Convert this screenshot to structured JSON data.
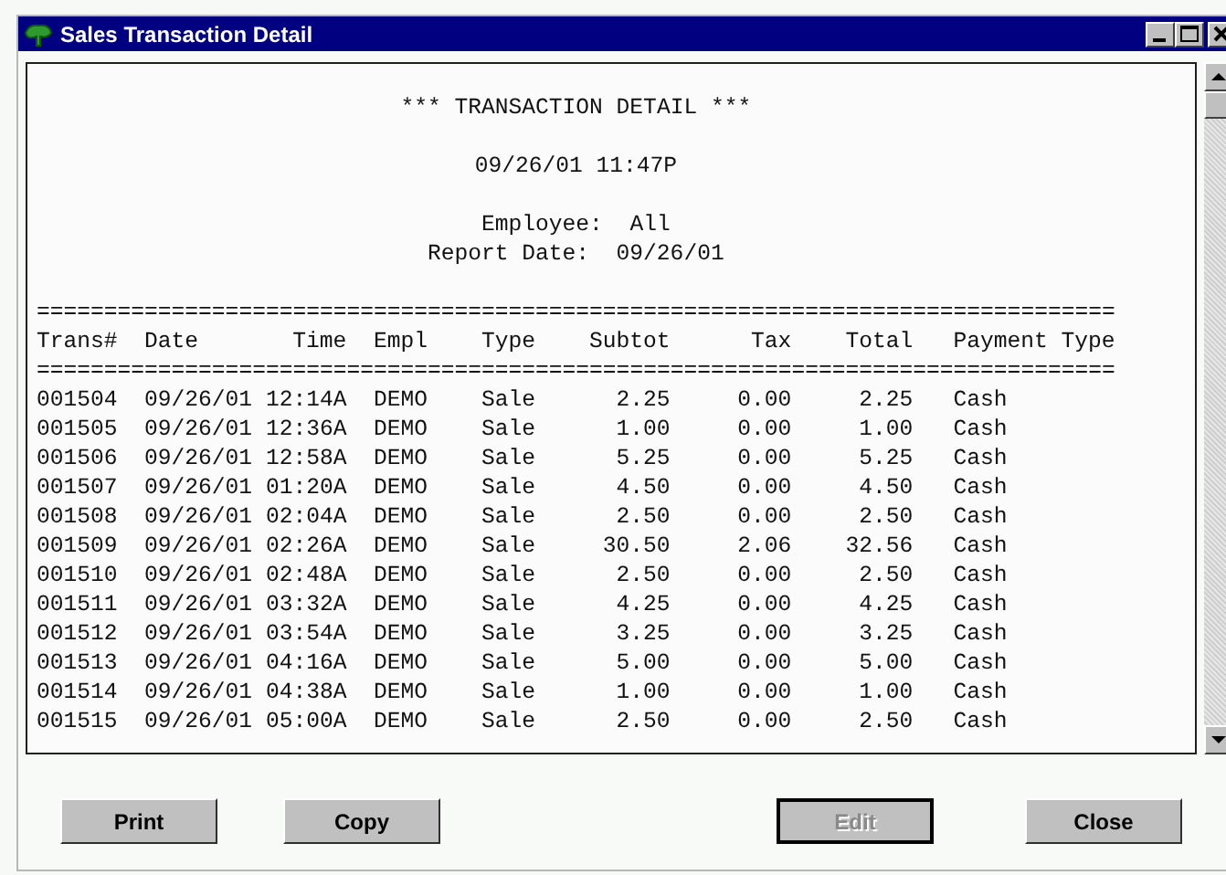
{
  "window": {
    "title": "Sales Transaction Detail"
  },
  "report": {
    "title": "*** TRANSACTION DETAIL ***",
    "timestamp": "09/26/01 11:47P",
    "employee": "Employee:  All",
    "report_date": "Report Date:  09/26/01",
    "rule_top": "================================================================================",
    "columns": [
      "Trans#",
      "Date",
      "Time",
      "Empl",
      "Type",
      "Subtot",
      "Tax",
      "Total",
      "Payment Type"
    ],
    "rule_bottom": "================================================================================",
    "rows": [
      [
        "001504",
        "09/26/01",
        "12:14A",
        "DEMO",
        "Sale",
        "2.25",
        "0.00",
        "2.25",
        "Cash"
      ],
      [
        "001505",
        "09/26/01",
        "12:36A",
        "DEMO",
        "Sale",
        "1.00",
        "0.00",
        "1.00",
        "Cash"
      ],
      [
        "001506",
        "09/26/01",
        "12:58A",
        "DEMO",
        "Sale",
        "5.25",
        "0.00",
        "5.25",
        "Cash"
      ],
      [
        "001507",
        "09/26/01",
        "01:20A",
        "DEMO",
        "Sale",
        "4.50",
        "0.00",
        "4.50",
        "Cash"
      ],
      [
        "001508",
        "09/26/01",
        "02:04A",
        "DEMO",
        "Sale",
        "2.50",
        "0.00",
        "2.50",
        "Cash"
      ],
      [
        "001509",
        "09/26/01",
        "02:26A",
        "DEMO",
        "Sale",
        "30.50",
        "2.06",
        "32.56",
        "Cash"
      ],
      [
        "001510",
        "09/26/01",
        "02:48A",
        "DEMO",
        "Sale",
        "2.50",
        "0.00",
        "2.50",
        "Cash"
      ],
      [
        "001511",
        "09/26/01",
        "03:32A",
        "DEMO",
        "Sale",
        "4.25",
        "0.00",
        "4.25",
        "Cash"
      ],
      [
        "001512",
        "09/26/01",
        "03:54A",
        "DEMO",
        "Sale",
        "3.25",
        "0.00",
        "3.25",
        "Cash"
      ],
      [
        "001513",
        "09/26/01",
        "04:16A",
        "DEMO",
        "Sale",
        "5.00",
        "0.00",
        "5.00",
        "Cash"
      ],
      [
        "001514",
        "09/26/01",
        "04:38A",
        "DEMO",
        "Sale",
        "1.00",
        "0.00",
        "1.00",
        "Cash"
      ],
      [
        "001515",
        "09/26/01",
        "05:00A",
        "DEMO",
        "Sale",
        "2.50",
        "0.00",
        "2.50",
        "Cash"
      ]
    ]
  },
  "buttons": [
    {
      "label": "Print",
      "disabled": false
    },
    {
      "label": "Copy",
      "disabled": false
    },
    {
      "label": "Edit",
      "disabled": true
    },
    {
      "label": "Close",
      "disabled": false
    }
  ]
}
